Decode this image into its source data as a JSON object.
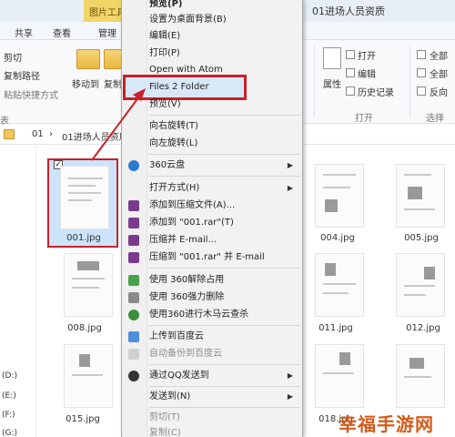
{
  "titlebar": {
    "context_tab": "图片工具",
    "window_title": "01进场人员资质"
  },
  "tabs": {
    "share": "共享",
    "view": "查看",
    "manage": "管理"
  },
  "ribbon": {
    "cut": "剪切",
    "copy_path": "复制路径",
    "paste_shortcut": "粘贴快捷方式",
    "move_to": "移动到",
    "copy_to": "复制",
    "properties": "属性",
    "open": "打开",
    "edit": "编辑",
    "history": "历史记录",
    "open_group": "打开",
    "select_all": "全部",
    "select_none": "全部",
    "invert": "反向",
    "select_group": "选择",
    "left_fragment": "表"
  },
  "address": {
    "root": "01",
    "folder": "01进场人员资质"
  },
  "drives": [
    "(D:)",
    "(E:)",
    "(F:)",
    "(G:)"
  ],
  "files": {
    "selected": "001.jpg",
    "f004": "004.jpg",
    "f005": "005.jpg",
    "f008": "008.jpg",
    "f011": "011.jpg",
    "f012": "012.jpg",
    "f015": "015.jpg",
    "f018": "018.jpg"
  },
  "menu": {
    "preview_top": "预览(P)",
    "set_desktop": "设置为桌面背景(B)",
    "edit": "编辑(E)",
    "print": "打印(P)",
    "open_atom": "Open with Atom",
    "files2folder": "Files 2 Folder",
    "preview": "预览(V)",
    "rotate_right": "向右旋转(T)",
    "rotate_left": "向左旋转(L)",
    "cloud360": "360云盘",
    "open_with": "打开方式(H)",
    "add_archive": "添加到压缩文件(A)...",
    "add_rar": "添加到 \"001.rar\"(T)",
    "compress_email": "压缩并 E-mail...",
    "compress_rar_email": "压缩到 \"001.rar\" 并 E-mail",
    "unlock360": "使用 360解除占用",
    "force_delete360": "使用 360强力删除",
    "scan360": "使用360进行木马云查杀",
    "upload_baidu": "上传到百度云",
    "auto_backup_baidu": "自动备份到百度云",
    "send_qq": "通过QQ发送到",
    "send_to": "发送到(N)",
    "cut": "剪切(T)",
    "copy": "复制(C)"
  },
  "watermark": "幸福手游网",
  "colors": {
    "highlight": "#c8202a",
    "selection": "#cce4fb",
    "context_tab": "#f2d569"
  }
}
